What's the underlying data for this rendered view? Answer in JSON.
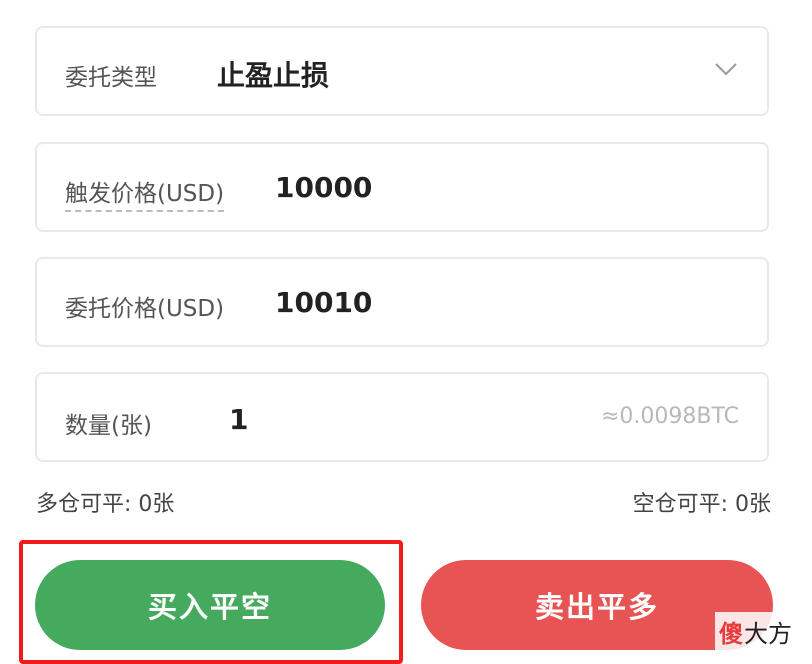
{
  "order_type": {
    "label": "委托类型",
    "value": "止盈止损",
    "icon": "chevron-down-icon"
  },
  "trigger_price": {
    "label": "触发价格(USD)",
    "value": "10000"
  },
  "order_price": {
    "label": "委托价格(USD)",
    "value": "10010"
  },
  "quantity": {
    "label": "数量(张)",
    "value": "1",
    "btc_equivalent": "≈0.0098BTC"
  },
  "availability": {
    "long_closable": "多仓可平: 0张",
    "short_closable": "空仓可平: 0张"
  },
  "actions": {
    "buy_close_short": "买入平空",
    "sell_close_long": "卖出平多"
  },
  "colors": {
    "buy": "#45aa5d",
    "sell": "#e85353",
    "highlight": "#ee1c1c"
  },
  "watermark": {
    "logo": "傻",
    "text": "大方"
  }
}
